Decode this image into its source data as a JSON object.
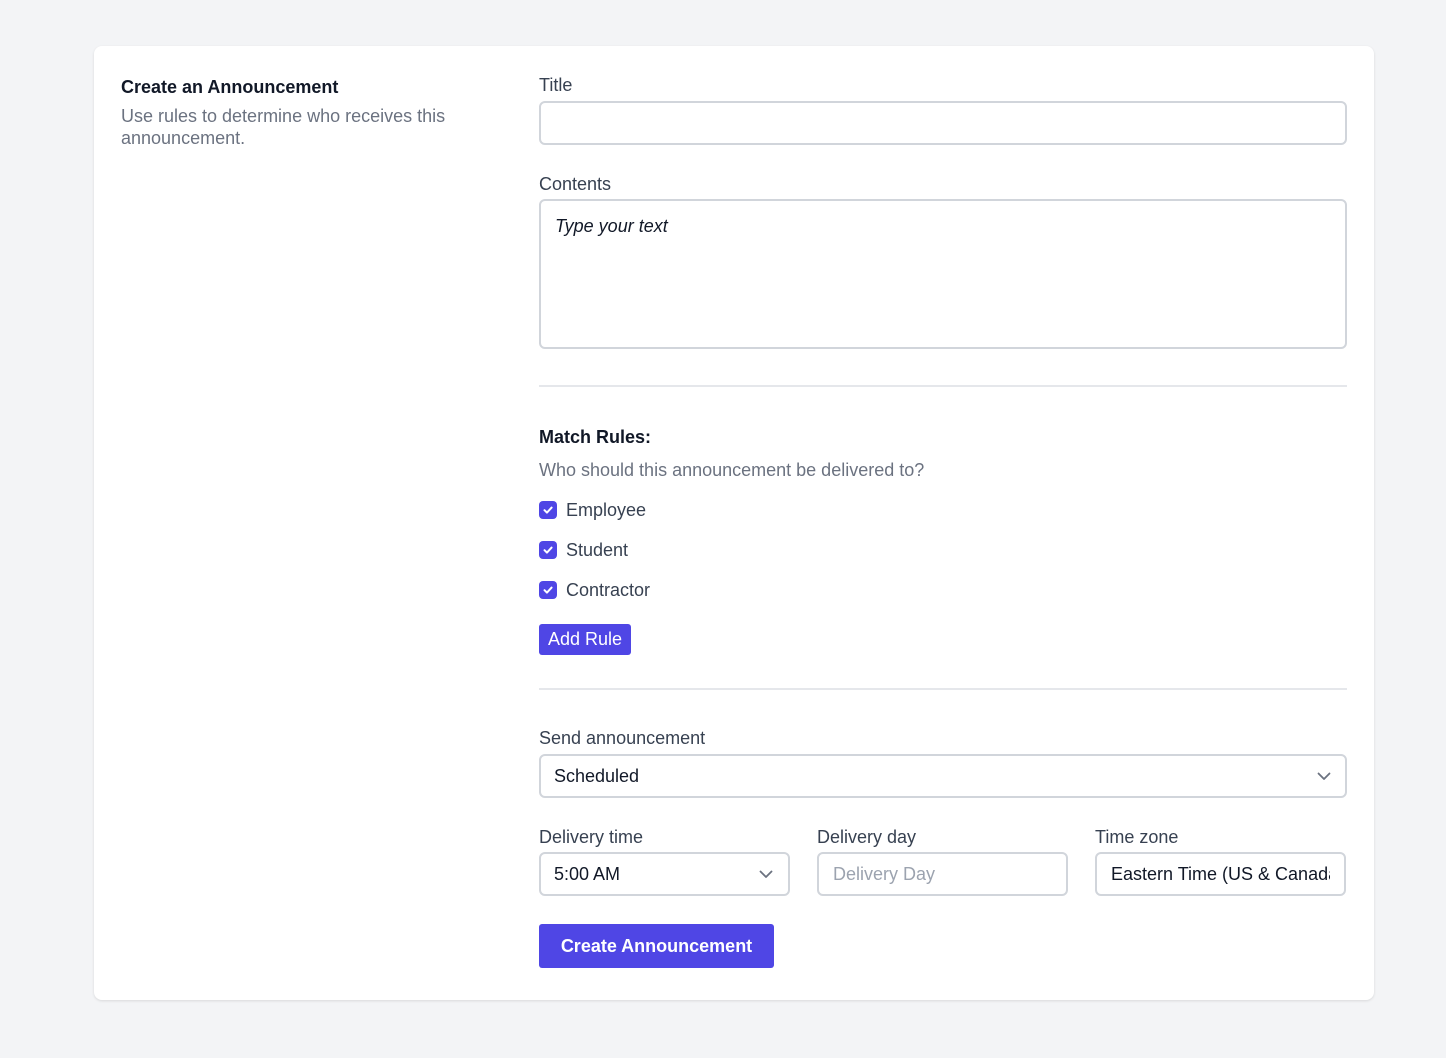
{
  "intro": {
    "title": "Create an Announcement",
    "description": "Use rules to determine who receives this announcement."
  },
  "form": {
    "title_label": "Title",
    "title_value": "",
    "contents_label": "Contents",
    "contents_placeholder": "Type your text",
    "match_rules": {
      "title": "Match Rules:",
      "description": "Who should this announcement be delivered to?",
      "options": [
        {
          "label": "Employee",
          "checked": true
        },
        {
          "label": "Student",
          "checked": true
        },
        {
          "label": "Contractor",
          "checked": true
        }
      ],
      "add_rule_label": "Add Rule"
    },
    "send": {
      "label": "Send announcement",
      "value": "Scheduled"
    },
    "delivery_time": {
      "label": "Delivery time",
      "value": "5:00 AM"
    },
    "delivery_day": {
      "label": "Delivery day",
      "placeholder": "Delivery Day"
    },
    "time_zone": {
      "label": "Time zone",
      "value": "Eastern Time (US & Canada)"
    },
    "submit_label": "Create Announcement"
  },
  "colors": {
    "accent": "#4f46e5",
    "background": "#f3f4f6",
    "border": "#d1d5db"
  },
  "icons": {
    "checkbox": "check-icon",
    "select": "chevron-down-icon"
  }
}
